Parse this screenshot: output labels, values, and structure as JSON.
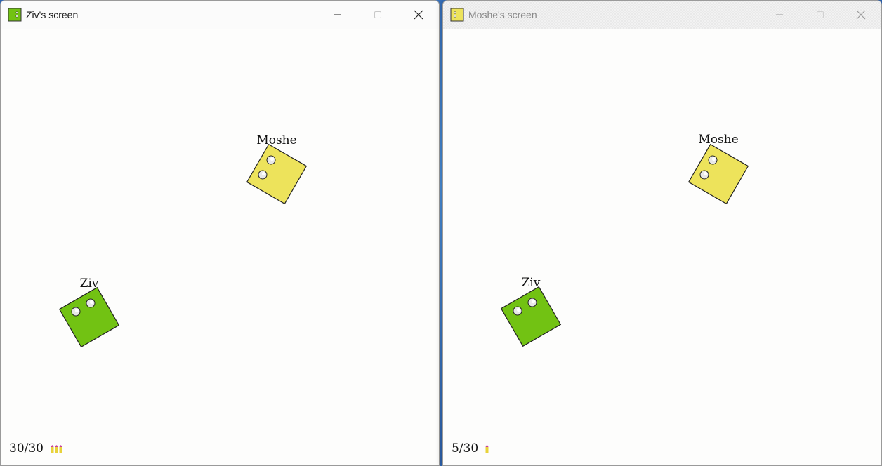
{
  "windows": [
    {
      "title": "Ziv's screen",
      "icon": "green-player-square-icon",
      "active": true,
      "ammo": {
        "current": 30,
        "max": 30,
        "text": "30/30",
        "bullet_icons": 3
      },
      "players": [
        {
          "name": "Moshe",
          "color": "#ede35b"
        },
        {
          "name": "Ziv",
          "color": "#72c213"
        }
      ]
    },
    {
      "title": "Moshe's screen",
      "icon": "yellow-player-square-icon",
      "active": false,
      "ammo": {
        "current": 5,
        "max": 30,
        "text": "5/30",
        "bullet_icons": 1
      },
      "players": [
        {
          "name": "Moshe",
          "color": "#ede35b"
        },
        {
          "name": "Ziv",
          "color": "#72c213"
        }
      ]
    }
  ],
  "colors": {
    "bullet_tip": "#c8409a",
    "bullet_body": "#e8d23a",
    "player_outline": "#222222"
  }
}
